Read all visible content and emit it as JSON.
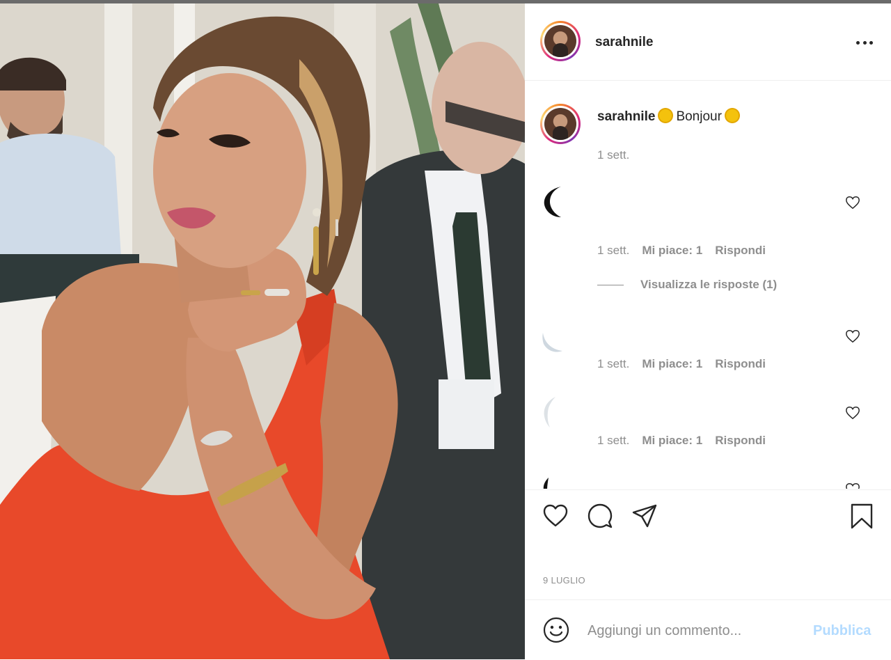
{
  "header": {
    "username": "sarahnile",
    "more_icon": "more-horizontal-icon"
  },
  "caption": {
    "username": "sarahnile",
    "text": "Bonjour",
    "time": "1 sett."
  },
  "comments": [
    {
      "time": "1 sett.",
      "likes": "Mi piace: 1",
      "reply": "Rispondi",
      "view_replies": "Visualizza le risposte (1)"
    },
    {
      "time": "1 sett.",
      "likes": "Mi piace: 1",
      "reply": "Rispondi"
    },
    {
      "time": "1 sett.",
      "likes": "Mi piace: 1",
      "reply": "Rispondi"
    }
  ],
  "actions": {
    "like_icon": "heart-icon",
    "comment_icon": "comment-icon",
    "share_icon": "share-icon",
    "save_icon": "bookmark-icon"
  },
  "post_date": "9 LUGLIO",
  "add_comment": {
    "placeholder": "Aggiungi un commento...",
    "publish_label": "Pubblica"
  },
  "colors": {
    "dress": "#e8492a",
    "link_disabled": "#b3dbff",
    "secondary_text": "#8e8e8e"
  }
}
